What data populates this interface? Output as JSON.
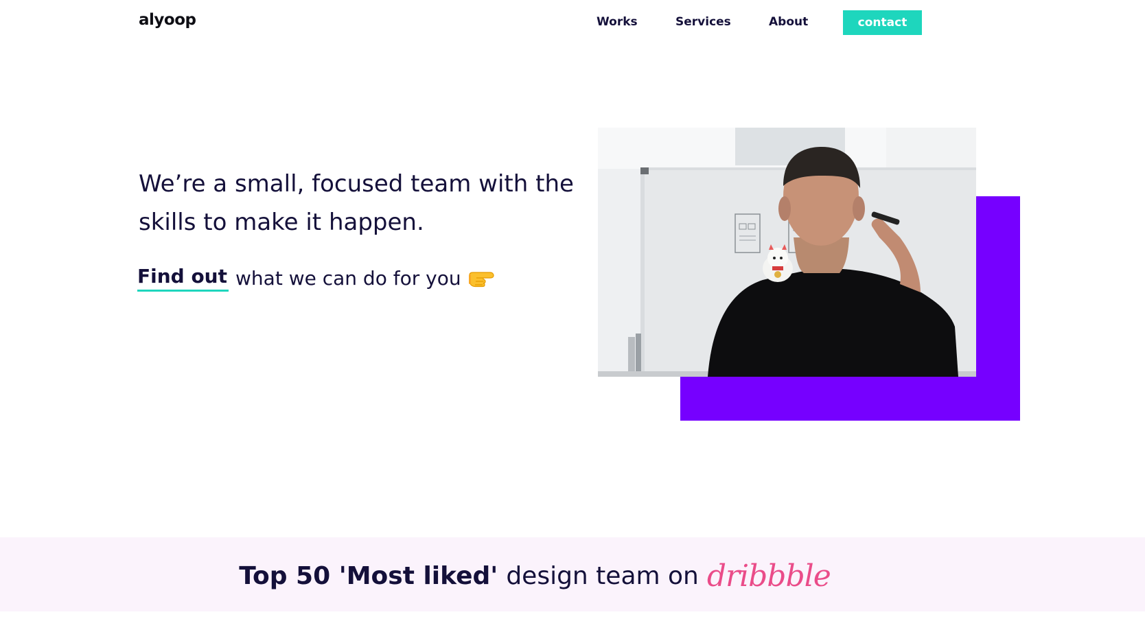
{
  "header": {
    "logo": "alyoop",
    "nav": [
      {
        "label": "Works"
      },
      {
        "label": "Services"
      },
      {
        "label": "About"
      }
    ],
    "contact_label": "contact"
  },
  "hero": {
    "headline": "We’re a small, focused team with the skills to make it happen.",
    "cta_link": "Find out",
    "cta_rest": "what we can do for you",
    "cta_icon": "pointing-hand-icon",
    "image": "photo-man-writing-on-whiteboard"
  },
  "banner": {
    "bold": "Top 50 'Most liked'",
    "rest": "design team on",
    "brand": "dribbble"
  },
  "colors": {
    "accent": "#1ed6bd",
    "purple": "#7600ff",
    "text": "#14103a",
    "dribbble_pink": "#ea4c89",
    "banner_bg": "#fbf3fc"
  }
}
